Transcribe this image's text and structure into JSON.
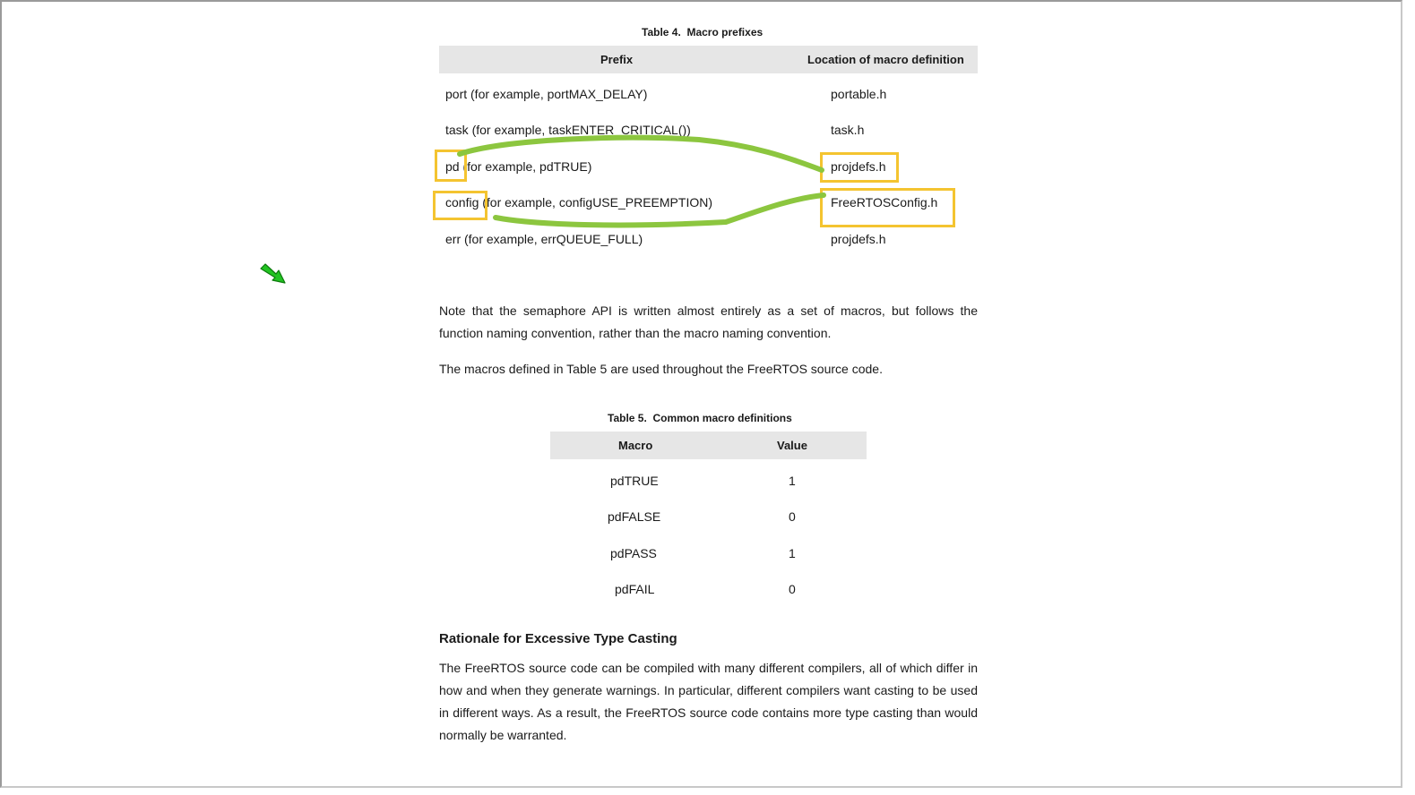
{
  "table4": {
    "caption": "Table 4.  Macro prefixes",
    "headers": [
      "Prefix",
      "Location of macro definition"
    ],
    "rows": [
      {
        "prefix": "port (for example, portMAX_DELAY)",
        "location": "portable.h"
      },
      {
        "prefix": "task (for example, taskENTER_CRITICAL())",
        "location": "task.h"
      },
      {
        "prefix_key": "pd",
        "prefix_rest": " (for example, pdTRUE)",
        "location": "projdefs.h"
      },
      {
        "prefix_key": "config",
        "prefix_rest": " (for example, configUSE_PREEMPTION)",
        "location": "FreeRTOSConfig.h"
      },
      {
        "prefix": "err (for example, errQUEUE_FULL)",
        "location": "projdefs.h"
      }
    ]
  },
  "para1": "Note that the semaphore API is written almost entirely as a set of macros, but follows the function naming convention, rather than the macro naming convention.",
  "para2": "The macros defined in Table 5 are used throughout the FreeRTOS source code.",
  "table5": {
    "caption": "Table 5.  Common macro definitions",
    "headers": [
      "Macro",
      "Value"
    ],
    "rows": [
      {
        "macro": "pdTRUE",
        "value": "1"
      },
      {
        "macro": "pdFALSE",
        "value": "0"
      },
      {
        "macro": "pdPASS",
        "value": "1"
      },
      {
        "macro": "pdFAIL",
        "value": "0"
      }
    ]
  },
  "section": {
    "heading": "Rationale for Excessive Type Casting",
    "body": "The FreeRTOS source code can be compiled with many different compilers, all of which differ in how and when they generate warnings.  In particular, different compilers want casting to be used in different ways.  As a result, the FreeRTOS source code contains more type casting than would normally be warranted."
  },
  "annotations": {
    "highlight_color": "#f4c430",
    "stroke_color": "#8cc63f",
    "cursor_color": "#22c322",
    "cursor_icon": "green-arrow-cursor-icon"
  }
}
